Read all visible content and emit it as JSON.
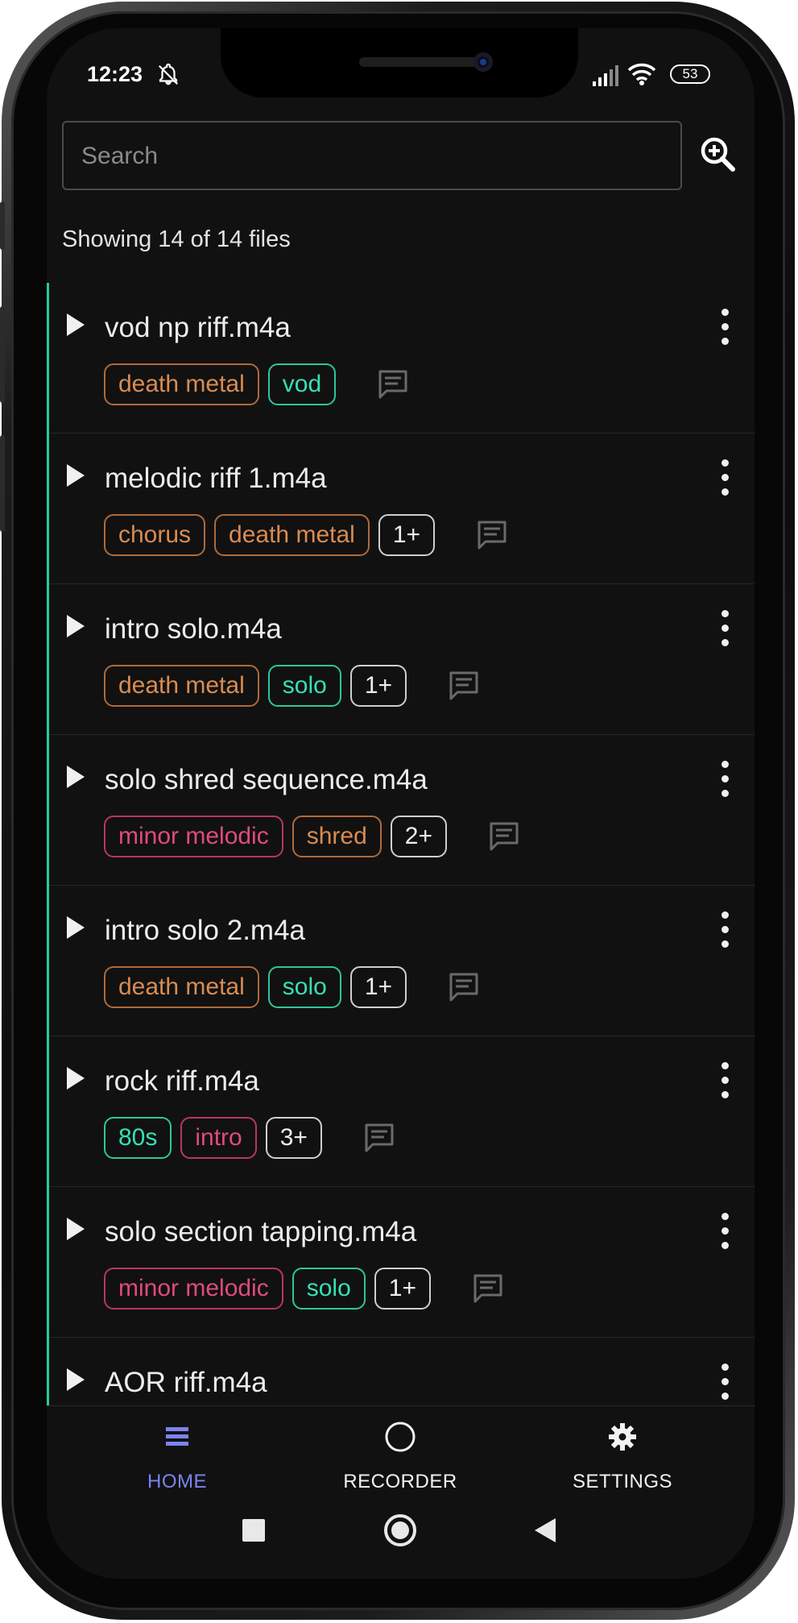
{
  "status_bar": {
    "time": "12:23",
    "battery": "53"
  },
  "search": {
    "placeholder": "Search",
    "value": ""
  },
  "summary": "Showing 14 of 14 files",
  "files": [
    {
      "name": "vod np riff.m4a",
      "tags": [
        {
          "label": "death metal",
          "color": "orange"
        },
        {
          "label": "vod",
          "color": "teal"
        }
      ]
    },
    {
      "name": "melodic riff 1.m4a",
      "tags": [
        {
          "label": "chorus",
          "color": "orange"
        },
        {
          "label": "death metal",
          "color": "orange"
        },
        {
          "label": "1+",
          "color": "more"
        }
      ]
    },
    {
      "name": "intro solo.m4a",
      "tags": [
        {
          "label": "death metal",
          "color": "orange"
        },
        {
          "label": "solo",
          "color": "teal"
        },
        {
          "label": "1+",
          "color": "more"
        }
      ]
    },
    {
      "name": "solo shred sequence.m4a",
      "tags": [
        {
          "label": "minor melodic",
          "color": "pink"
        },
        {
          "label": "shred",
          "color": "orange"
        },
        {
          "label": "2+",
          "color": "more"
        }
      ]
    },
    {
      "name": "intro solo 2.m4a",
      "tags": [
        {
          "label": "death metal",
          "color": "orange"
        },
        {
          "label": "solo",
          "color": "teal"
        },
        {
          "label": "1+",
          "color": "more"
        }
      ]
    },
    {
      "name": "rock riff.m4a",
      "tags": [
        {
          "label": "80s",
          "color": "teal"
        },
        {
          "label": "intro",
          "color": "pink"
        },
        {
          "label": "3+",
          "color": "more"
        }
      ]
    },
    {
      "name": "solo section tapping.m4a",
      "tags": [
        {
          "label": "minor melodic",
          "color": "pink"
        },
        {
          "label": "solo",
          "color": "teal"
        },
        {
          "label": "1+",
          "color": "more"
        }
      ]
    },
    {
      "name": "AOR riff.m4a",
      "tags": []
    }
  ],
  "nav": {
    "home": "HOME",
    "recorder": "RECORDER",
    "settings": "SETTINGS",
    "active": "home"
  },
  "colors": {
    "accent_nav": "#7b84f0",
    "accent_teal": "#2cc79d",
    "tag_orange": "#d98c52",
    "tag_pink": "#e04a7e",
    "background": "#111111"
  }
}
